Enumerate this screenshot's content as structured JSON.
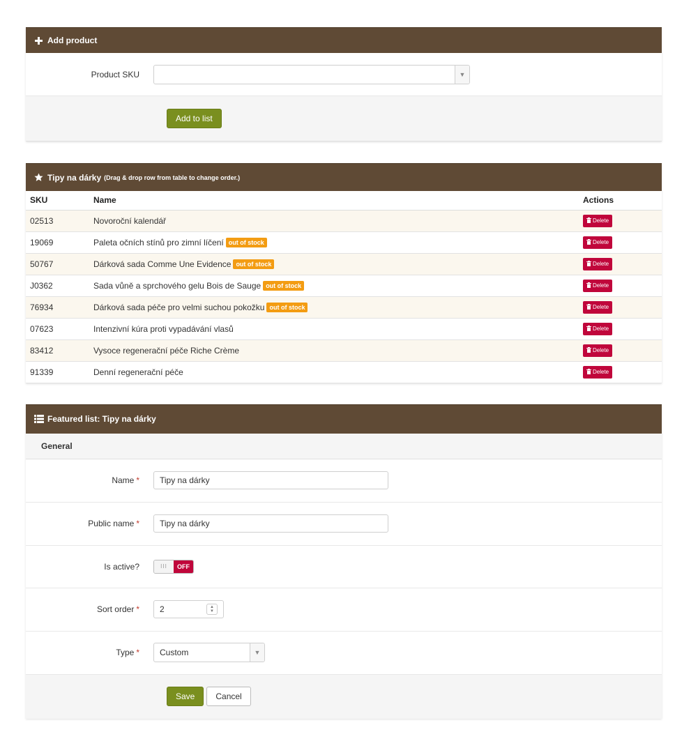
{
  "add_product": {
    "title": "Add product",
    "sku_label": "Product SKU",
    "sku_value": "",
    "add_button": "Add to list"
  },
  "list_panel": {
    "title": "Tipy na dárky",
    "subtitle": "(Drag & drop row from table to change order.)",
    "columns": {
      "sku": "SKU",
      "name": "Name",
      "actions": "Actions"
    },
    "badge_text": "out of stock",
    "delete_label": "Delete",
    "rows": [
      {
        "sku": "02513",
        "name": "Novoroční kalendář",
        "out_of_stock": false
      },
      {
        "sku": "19069",
        "name": "Paleta očních stínů pro zimní líčení",
        "out_of_stock": true
      },
      {
        "sku": "50767",
        "name": "Dárková sada Comme Une Evidence",
        "out_of_stock": true
      },
      {
        "sku": "J0362",
        "name": "Sada vůně a sprchového gelu Bois de Sauge",
        "out_of_stock": true
      },
      {
        "sku": "76934",
        "name": "Dárková sada péče pro velmi suchou pokožku",
        "out_of_stock": true
      },
      {
        "sku": "07623",
        "name": "Intenzivní kúra proti vypadávání vlasů",
        "out_of_stock": false
      },
      {
        "sku": "83412",
        "name": "Vysoce regenerační péče Riche Crème",
        "out_of_stock": false
      },
      {
        "sku": "91339",
        "name": "Denní regenerační péče",
        "out_of_stock": false
      }
    ]
  },
  "featured": {
    "title": "Featured list: Tipy na dárky",
    "section": "General",
    "name_label": "Name",
    "name_value": "Tipy na dárky",
    "public_name_label": "Public name",
    "public_name_value": "Tipy na dárky",
    "active_label": "Is active?",
    "toggle_off": "OFF",
    "toggle_on_glyph": "III",
    "sort_label": "Sort order",
    "sort_value": "2",
    "type_label": "Type",
    "type_value": "Custom",
    "save": "Save",
    "cancel": "Cancel",
    "required_mark": "*"
  },
  "colors": {
    "header_bg": "#5f4a35",
    "green_button": "#7a8f1f",
    "delete_button": "#c0063b",
    "badge": "#f39c12"
  }
}
